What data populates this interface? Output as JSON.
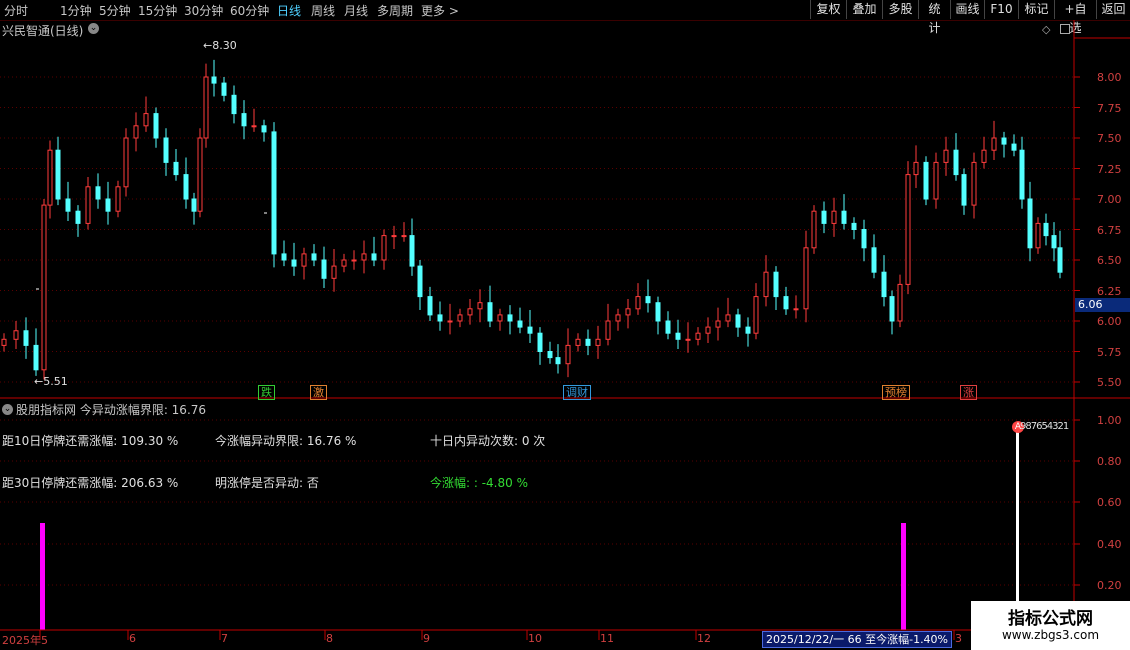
{
  "toolbar": {
    "periods": [
      "分时",
      "1分钟",
      "5分钟",
      "15分钟",
      "30分钟",
      "60分钟",
      "日线",
      "周线",
      "月线",
      "多周期",
      "更多 >"
    ],
    "active": "日线",
    "right_buttons": [
      "复权",
      "叠加",
      "多股",
      "统计",
      "画线",
      "F10",
      "标记",
      "+自选",
      "返回"
    ]
  },
  "chart": {
    "stock_title": "兴民智通(日线)",
    "high_label": "8.30",
    "low_label": "5.51",
    "current_price": "6.06",
    "price_ticks": [
      "8.00",
      "7.75",
      "7.50",
      "7.25",
      "7.00",
      "6.75",
      "6.50",
      "6.25",
      "6.00",
      "5.75",
      "5.50"
    ],
    "event_tags": [
      {
        "text": "跌",
        "color": "#33cc33"
      },
      {
        "text": "激",
        "color": "#e08030"
      },
      {
        "text": "调财",
        "color": "#3399dd"
      },
      {
        "text": "预榜",
        "color": "#e08030"
      },
      {
        "text": "涨",
        "color": "#e04040"
      }
    ]
  },
  "indicator": {
    "header": "股朋指标网  今异动涨幅界限: 16.76",
    "line1_a": "距10日停牌还需涨幅: 109.30 %",
    "line1_b": "今涨幅异动界限: 16.76 %",
    "line1_c": "十日内异动次数: 0 次",
    "line2_a": "距30日停牌还需涨幅: 206.63 %",
    "line2_b": "明涨停是否异动: 否",
    "line2_c": "今涨幅: : -4.80 %",
    "ticks": [
      "1.00",
      "0.80",
      "0.60",
      "0.40",
      "0.20"
    ],
    "marker_text": "987654321"
  },
  "timeline": {
    "months": [
      "2025年5",
      "6",
      "7",
      "8",
      "9",
      "10",
      "11",
      "12",
      "3"
    ],
    "status": "2025/12/22/一 66 至今涨幅-1.40%"
  },
  "watermark": {
    "title": "指标公式网",
    "url": "www.zbgs3.com"
  },
  "colors": {
    "up": "#ff3c3c",
    "down": "#54ffff",
    "magenta": "#ff00ff",
    "axis": "#c00000"
  }
}
